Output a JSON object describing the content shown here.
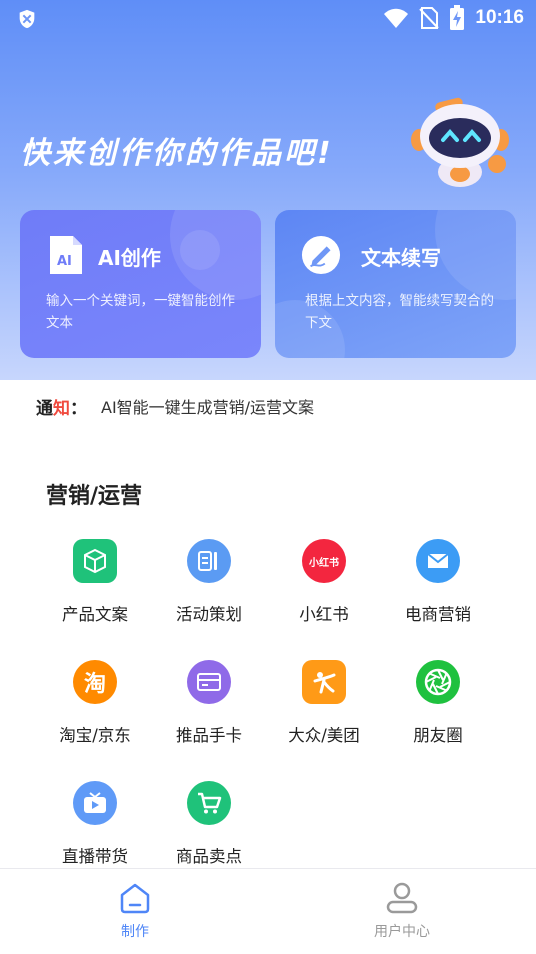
{
  "status_bar": {
    "time": "10:16"
  },
  "hero": {
    "title": "快来创作你的作品吧!"
  },
  "cards": [
    {
      "title": "AI创作",
      "desc": "输入一个关键词，一键智能创作文本",
      "icon_text": "AI",
      "icon": "document-ai-icon"
    },
    {
      "title": "文本续写",
      "desc": "根据上文内容，智能续写契合的下文",
      "icon": "pen-circle-icon"
    }
  ],
  "notice": {
    "label_black": "通",
    "label_red": "知",
    "label_colon": "：",
    "text": "AI智能一键生成营销/运营文案"
  },
  "section": {
    "title": "营销/运营",
    "items": [
      {
        "label": "产品文案",
        "icon": "cube-icon",
        "color": "#1fc27a"
      },
      {
        "label": "活动策划",
        "icon": "document-lines-icon",
        "color": "#5b9bf3"
      },
      {
        "label": "小红书",
        "icon": "xiaohongshu-logo-icon",
        "color": "#f3263f",
        "logo_text": "小红书"
      },
      {
        "label": "电商营销",
        "icon": "envelope-icon",
        "color": "#3c9cf5"
      },
      {
        "label": "淘宝/京东",
        "icon": "taobao-logo-icon",
        "color": "#ff8a00",
        "logo_text": "淘"
      },
      {
        "label": "推品手卡",
        "icon": "card-icon",
        "color": "#8f6ae8"
      },
      {
        "label": "大众/美团",
        "icon": "dianping-logo-icon",
        "color": "#ff9a17"
      },
      {
        "label": "朋友圈",
        "icon": "aperture-icon",
        "color": "#1fc13f"
      },
      {
        "label": "直播带货",
        "icon": "tv-play-icon",
        "color": "#5f9af7"
      },
      {
        "label": "商品卖点",
        "icon": "cart-icon",
        "color": "#1fc27a"
      }
    ]
  },
  "tabbar": {
    "active_color": "#4f86f7",
    "inactive_color": "#9a9a9a",
    "tabs": [
      {
        "label": "制作",
        "icon": "home-icon",
        "active": true
      },
      {
        "label": "用户中心",
        "icon": "user-icon",
        "active": false
      }
    ]
  }
}
